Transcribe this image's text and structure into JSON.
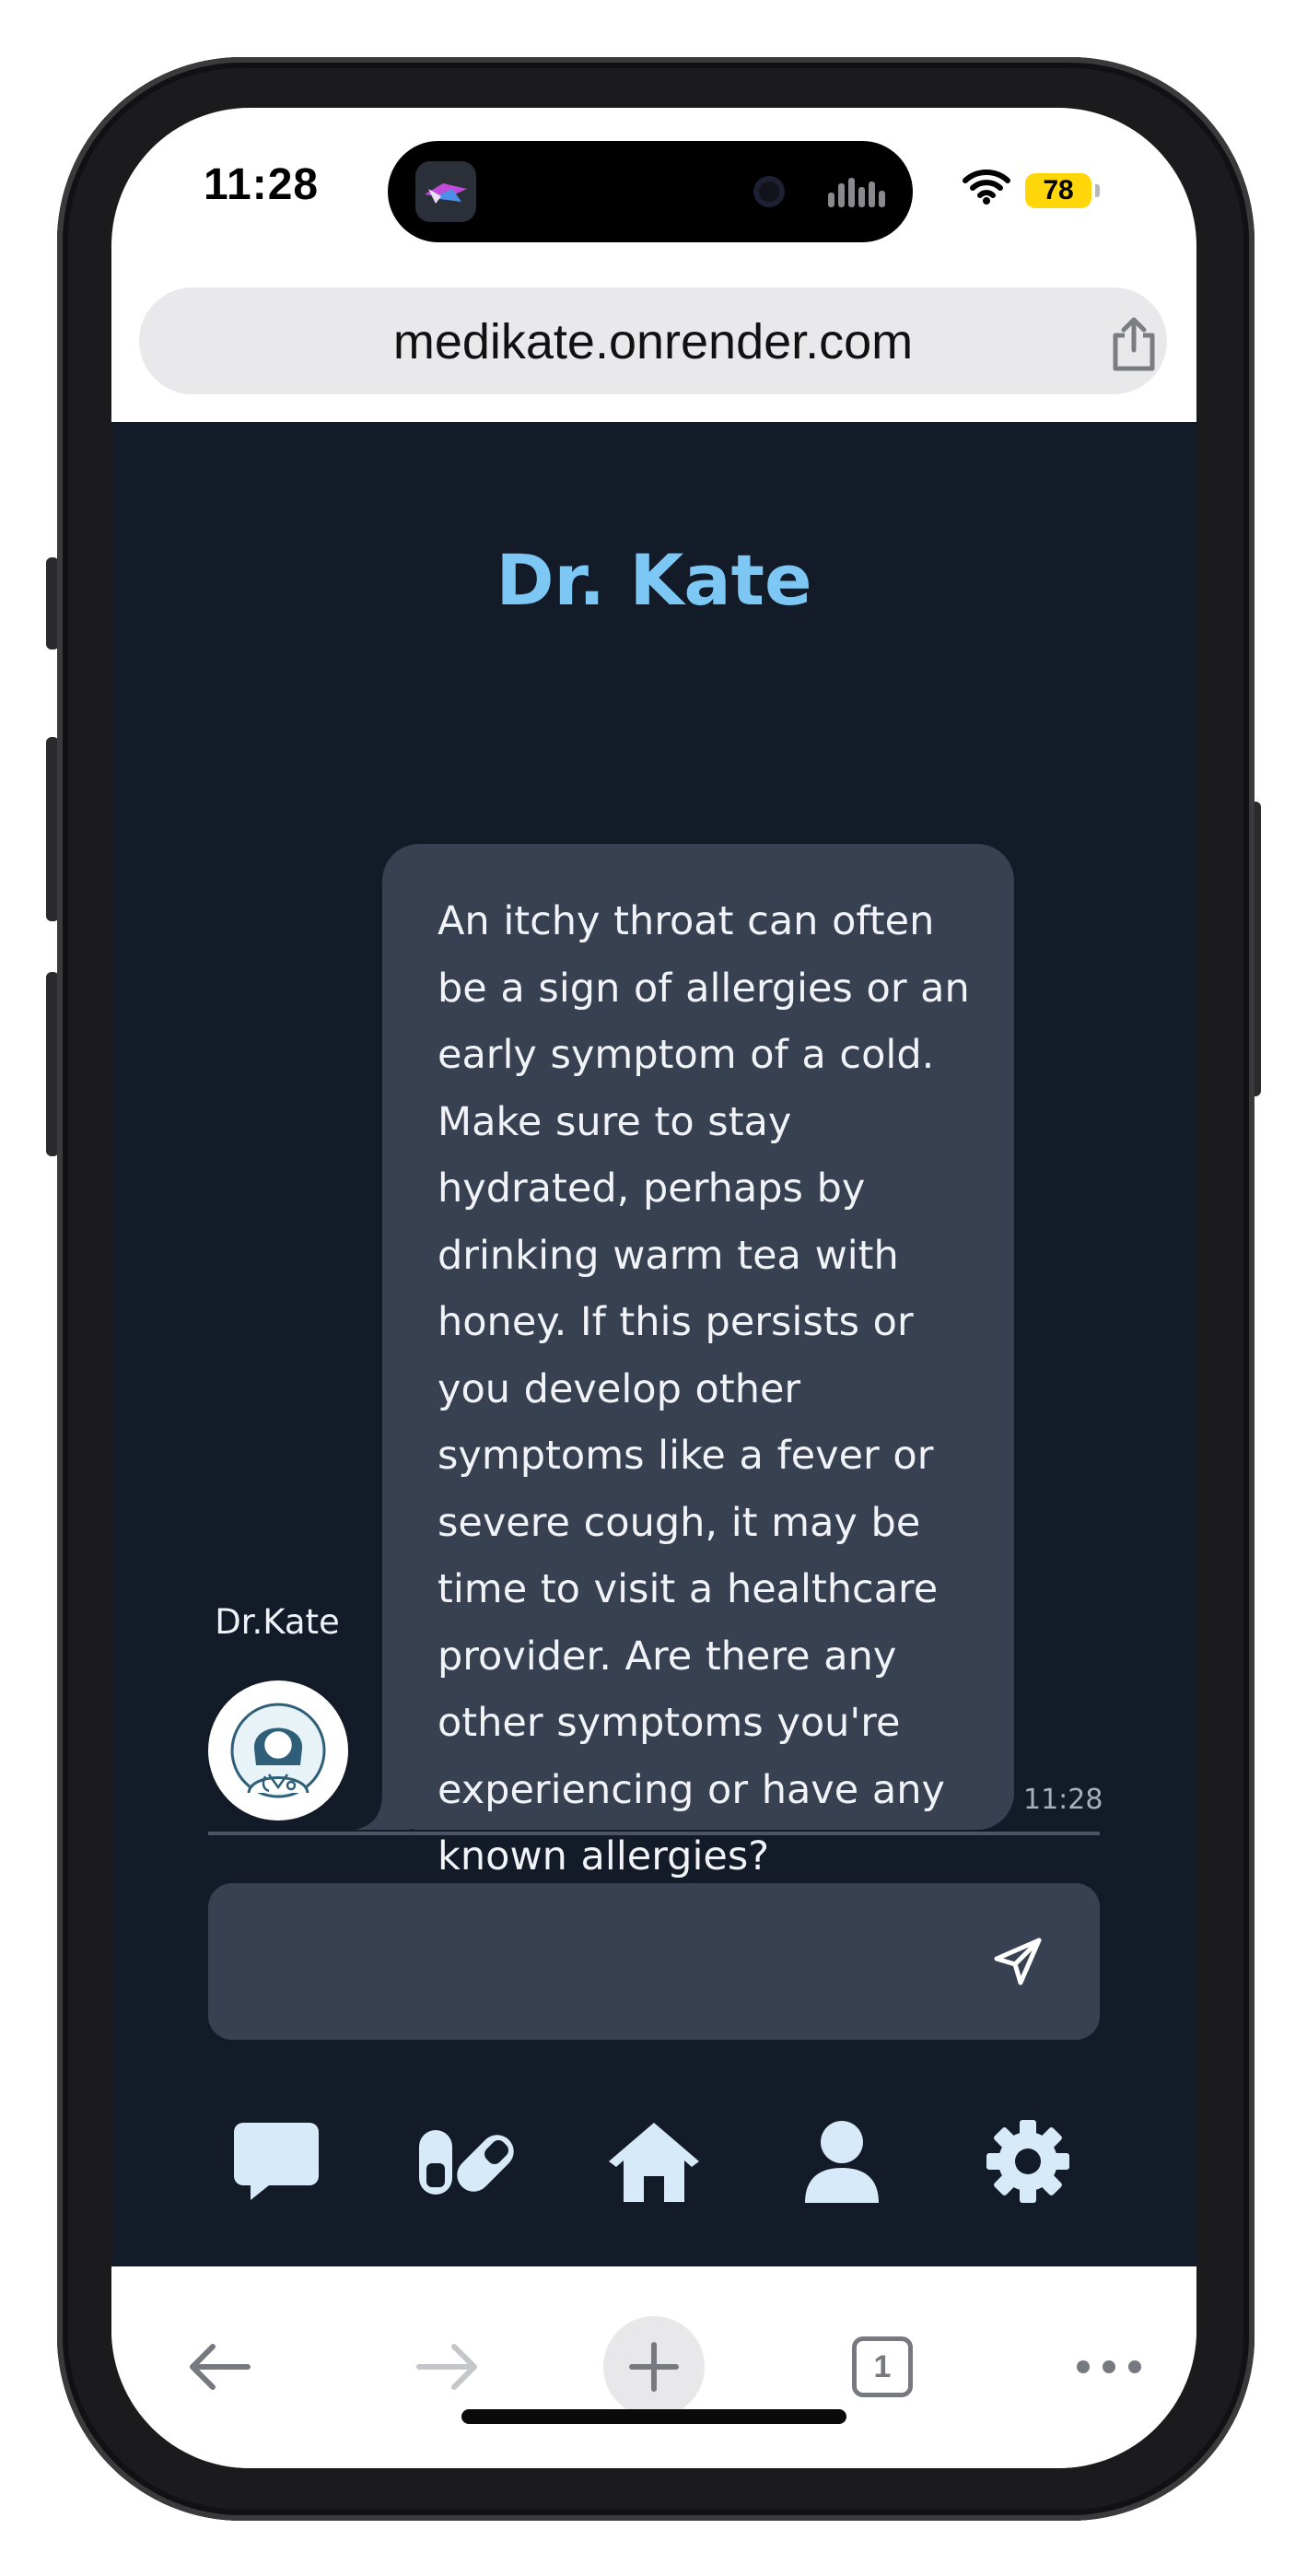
{
  "status_bar": {
    "time": "11:28",
    "battery": "78"
  },
  "browser": {
    "url": "medikate.onrender.com",
    "tab_count": "1"
  },
  "app": {
    "title": "Dr. Kate"
  },
  "chat": {
    "message": {
      "sender": "Dr.Kate",
      "text": "An itchy throat can often be a sign of allergies or an early symptom of a cold. Make sure to stay hydrated, perhaps by drinking warm tea with honey. If this persists or you develop other symptoms like a fever or severe cough, it may be time to visit a healthcare provider. Are there any other symptoms you're experiencing or have any known allergies?",
      "time": "11:28"
    },
    "composer": {
      "value": "",
      "placeholder": ""
    }
  },
  "nav": {
    "items": [
      {
        "icon": "chat-bubble-icon"
      },
      {
        "icon": "pills-icon"
      },
      {
        "icon": "home-icon"
      },
      {
        "icon": "user-icon"
      },
      {
        "icon": "gear-icon"
      }
    ]
  },
  "colors": {
    "app_background": "#131a28",
    "accent_title": "#7cc7f4",
    "bubble": "#374151",
    "nav_icons": "#d6eafa",
    "battery": "#ffd60a"
  }
}
